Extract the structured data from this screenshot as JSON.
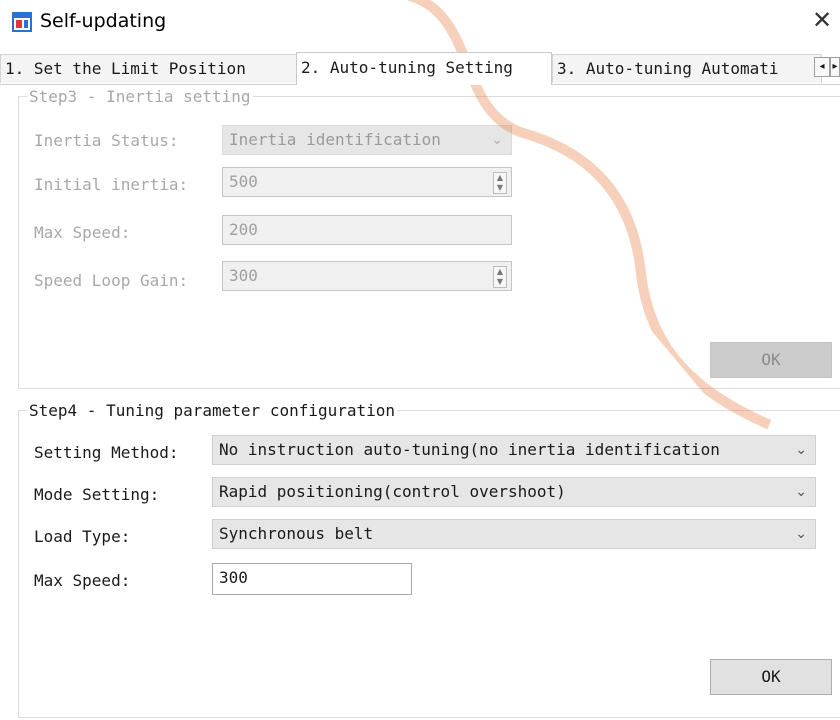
{
  "window": {
    "title": "Self-updating",
    "close_glyph": "✕"
  },
  "tabs": [
    {
      "label": "1. Set the Limit Position",
      "active": false
    },
    {
      "label": "2. Auto-tuning Setting",
      "active": true
    },
    {
      "label": "3. Auto-tuning Automati",
      "active": false
    }
  ],
  "tab_scroll": {
    "left": "◂",
    "right": "▸"
  },
  "step3": {
    "legend": "Step3 - Inertia setting",
    "inertia_status": {
      "label": "Inertia Status:",
      "value": "Inertia identification"
    },
    "initial_inertia": {
      "label": "Initial inertia:",
      "value": "500"
    },
    "max_speed": {
      "label": "Max Speed:",
      "value": "200"
    },
    "speed_loop_gain": {
      "label": "Speed Loop Gain:",
      "value": "300"
    },
    "ok_label": "OK"
  },
  "step4": {
    "legend": "Step4 - Tuning parameter configuration",
    "setting_method": {
      "label": "Setting Method:",
      "value": "No instruction auto-tuning(no inertia identification"
    },
    "mode_setting": {
      "label": "Mode Setting:",
      "value": "Rapid positioning(control overshoot)"
    },
    "load_type": {
      "label": "Load Type:",
      "value": "Synchronous belt"
    },
    "max_speed": {
      "label": "Max Speed:",
      "value": "300"
    },
    "ok_label": "OK"
  },
  "icons": {
    "app": "app-window-icon",
    "close": "close-icon",
    "chevron": "chevron-down-icon",
    "spin": "spin-arrows-icon"
  },
  "colors": {
    "disabled_text": "#a8a8a8",
    "watermark": "#e67a3c",
    "app_icon": "#2a6fd6"
  }
}
